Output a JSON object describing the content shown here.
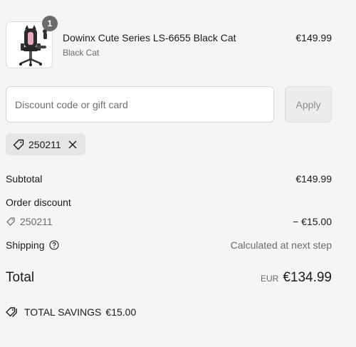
{
  "product": {
    "name": "Dowinx Cute Series LS-6655 Black Cat",
    "variant": "Black Cat",
    "price": "€149.99",
    "quantity": "1",
    "image_icon": "gaming-chair-icon"
  },
  "discount": {
    "placeholder": "Discount code or gift card",
    "apply_label": "Apply",
    "applied_code": "250211"
  },
  "summary": {
    "subtotal_label": "Subtotal",
    "subtotal_value": "€149.99",
    "order_discount_label": "Order discount",
    "discount_code": "250211",
    "discount_value": "− €15.00",
    "shipping_label": "Shipping",
    "shipping_value": "Calculated at next step",
    "total_label": "Total",
    "currency": "EUR",
    "total_value": "€134.99",
    "savings_label": "TOTAL SAVINGS",
    "savings_value": "€15.00"
  }
}
